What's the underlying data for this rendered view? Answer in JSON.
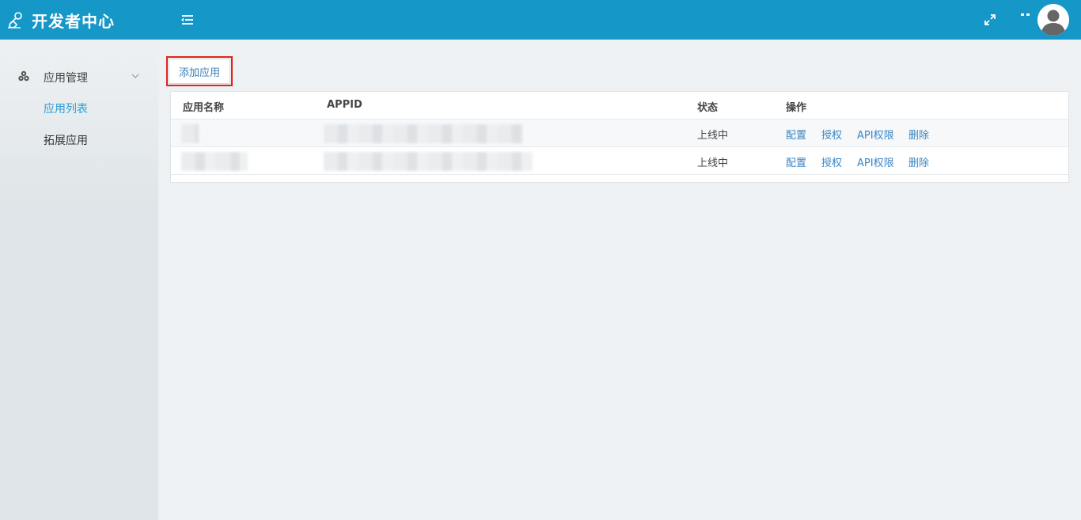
{
  "header": {
    "title": "开发者中心",
    "icons": {
      "logo": "developer-logo-icon",
      "menu_toggle": "menu-toggle-icon",
      "fullscreen": "expand-icon",
      "more": "more-icon",
      "avatar": "user-avatar"
    }
  },
  "sidebar": {
    "group_label": "应用管理",
    "group_icon": "cubes-icon",
    "items": [
      {
        "label": "应用列表",
        "active": true
      },
      {
        "label": "拓展应用",
        "active": false
      }
    ]
  },
  "toolbar": {
    "add_label": "添加应用"
  },
  "table": {
    "headers": [
      "应用名称",
      "APPID",
      "状态",
      "操作"
    ],
    "rows": [
      {
        "status": "上线中",
        "actions": [
          "配置",
          "授权",
          "API权限",
          "删除"
        ]
      },
      {
        "status": "上线中",
        "actions": [
          "配置",
          "授权",
          "API权限",
          "删除"
        ]
      }
    ]
  },
  "colors": {
    "header_bg": "#1597c7",
    "accent": "#2aa0d2",
    "link": "#3a86c4",
    "highlight_border": "#e0241b"
  }
}
